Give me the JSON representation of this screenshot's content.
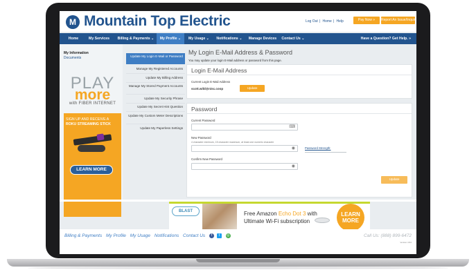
{
  "header": {
    "logo_text": "Mountain Top Electric",
    "top_links": [
      "Log Out",
      "Home",
      "Help"
    ],
    "pay_now": "Pay Now »",
    "report_issue": "Report An Issue/Inquiry"
  },
  "nav": {
    "items": [
      "Home",
      "My Services",
      "Billing & Payments ⌄",
      "My Profile ⌄",
      "My Usage ⌄",
      "Notifications ⌄",
      "Manage Devices",
      "Contact Us ⌄"
    ],
    "right": "Have a Question? Get Help. »"
  },
  "sidebar": {
    "heading": "My Information",
    "link": "Documents"
  },
  "ad": {
    "play": "PLAY",
    "more": "more",
    "fiber": "with FIBER INTERNET",
    "promo_line1": "SIGN UP AND RECEIVE A",
    "promo_line2": "ROKU STREAMING STICK",
    "learn_more": "LEARN MORE"
  },
  "subnav": {
    "items": [
      "Update My Login E-Mail or Password",
      "Manage My Registered Accounts",
      "Update My Billing Address",
      "Manage My Stored Payment Accounts",
      "Update My Security Phrase",
      "Update My Secret Hint Question",
      "Update My Custom Meter Descriptions",
      "Update My Paperless Settings"
    ]
  },
  "content": {
    "title": "My Login E-Mail Address & Password",
    "subtitle": "You may update your login E-Mail address or password from this page.",
    "email_section": {
      "title": "Login E-Mail Address",
      "current_label": "Current Login E-Mail Address",
      "current_value": "scott.wild@nisc.coop",
      "update": "Update"
    },
    "password_section": {
      "title": "Password",
      "current_label": "Current Password",
      "new_label": "New Password",
      "hint": "4 character minimum, 15 character maximum, at least one numeric character",
      "strength": "Password Strength:",
      "confirm_label": "Confirm New Password",
      "update": "Update"
    }
  },
  "banner": {
    "brand": "BLAST",
    "line1_a": "Free Amazon ",
    "line1_b": "Echo Dot 3",
    "line1_c": " with",
    "line2": "Ultimate Wi-Fi subscription",
    "learn": "LEARN",
    "more": "MORE"
  },
  "footer": {
    "links": [
      "Billing & Payments",
      "My Profile",
      "My Usage",
      "Notifications",
      "Contact Us"
    ],
    "call_us": "Call Us: (888) 899-6472",
    "version": "Version 18.0"
  },
  "colors": {
    "brand_blue": "#22548e",
    "accent_orange": "#f5a623",
    "active_blue": "#3f7ec4"
  }
}
